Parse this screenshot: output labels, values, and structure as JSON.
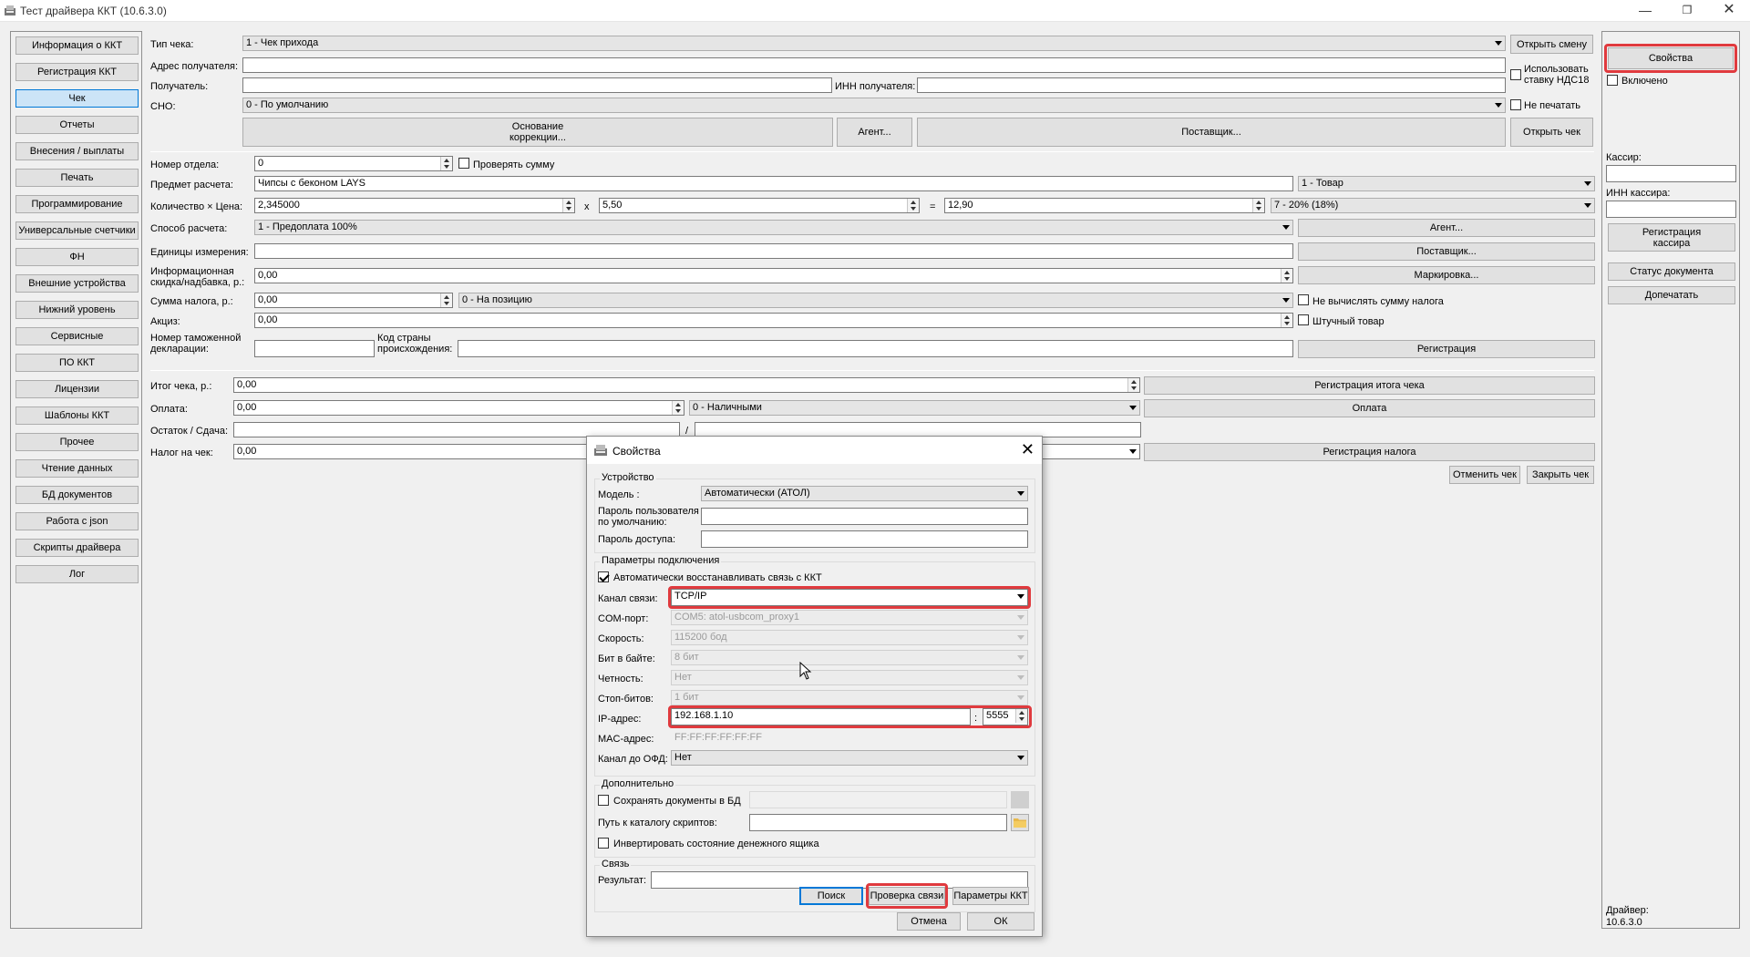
{
  "window": {
    "title": "Тест драйвера ККТ (10.6.3.0)"
  },
  "nav": [
    "Информация о ККТ",
    "Регистрация ККТ",
    "Чек",
    "Отчеты",
    "Внесения / выплаты",
    "Печать",
    "Программирование",
    "Универсальные счетчики",
    "ФН",
    "Внешние устройства",
    "Нижний уровень",
    "Сервисные",
    "ПО ККТ",
    "Лицензии",
    "Шаблоны ККТ",
    "Прочее",
    "Чтение данных",
    "БД документов",
    "Работа с json",
    "Скрипты драйвера",
    "Лог"
  ],
  "receipt": {
    "type_label": "Тип чека:",
    "type_value": "1 - Чек прихода",
    "open_shift": "Открыть смену",
    "addr_label": "Адрес получателя:",
    "use_vat_label": "Использовать\nставку НДС18",
    "recipient_label": "Получатель:",
    "inn_label": "ИНН получателя:",
    "sno_label": "СНО:",
    "sno_value": "0 - По умолчанию",
    "no_print_label": "Не печатать",
    "basis_btn": "Основание\nкоррекции...",
    "agent_btn": "Агент...",
    "supplier_btn": "Поставщик...",
    "open_receipt_btn": "Открыть чек",
    "dept_label": "Номер отдела:",
    "dept_value": "0",
    "check_sum_label": "Проверять сумму",
    "item_label": "Предмет расчета:",
    "item_value": "Чипсы с беконом LAYS",
    "item_type_value": "1 - Товар",
    "qty_price_label": "Количество × Цена:",
    "qty_value": "2,345000",
    "x_sign": "x",
    "price_value": "5,50",
    "eq_sign": "=",
    "total_value": "12,90",
    "vat_value": "7 - 20% (18%)",
    "pay_method_label": "Способ расчета:",
    "pay_method_value": "1 - Предоплата 100%",
    "agent2_btn": "Агент...",
    "unit_label": "Единицы измерения:",
    "supplier2_btn": "Поставщик...",
    "info_discount_label": "Информационная\nскидка/надбавка, р.:",
    "info_discount_value": "0,00",
    "marking_btn": "Маркировка...",
    "tax_sum_label": "Сумма налога, р.:",
    "tax_sum_value": "0,00",
    "tax_mode_value": "0 - На позицию",
    "no_calc_tax_label": "Не вычислять сумму налога",
    "excise_label": "Акциз:",
    "excise_value": "0,00",
    "piece_label": "Штучный товар",
    "customs_label": "Номер таможенной\nдекларации:",
    "country_label": "Код страны\nпроисхождения:",
    "register_btn": "Регистрация",
    "total_label": "Итог чека, р.:",
    "total2_value": "0,00",
    "register_total_btn": "Регистрация итога чека",
    "payment_label": "Оплата:",
    "payment_value": "0,00",
    "payment_type_value": "0 - Наличными",
    "payment_btn": "Оплата",
    "change_label": "Остаток / Сдача:",
    "slash": "/",
    "tax_receipt_label": "Налог на чек:",
    "tax_receipt_value": "0,00",
    "register_tax_btn": "Регистрация налога",
    "cancel_receipt_btn": "Отменить чек",
    "close_receipt_btn": "Закрыть чек"
  },
  "right": {
    "props_btn": "Свойства",
    "enabled_label": "Включено",
    "cashier_label": "Кассир:",
    "cashier_inn_label": "ИНН кассира:",
    "register_cashier_btn": "Регистрация\nкассира",
    "doc_status_btn": "Статус документа",
    "reprint_btn": "Допечатать",
    "driver_label": "Драйвер:",
    "driver_version": "10.6.3.0"
  },
  "dialog": {
    "title": "Свойства",
    "device_group": "Устройство",
    "model_label": "Модель :",
    "model_value": "Автоматически (АТОЛ)",
    "user_pwd_label": "Пароль пользователя\nпо умолчанию:",
    "access_pwd_label": "Пароль доступа:",
    "conn_group": "Параметры подключения",
    "auto_restore_label": "Автоматически восстанавливать связь с ККТ",
    "channel_label": "Канал связи:",
    "channel_value": "TCP/IP",
    "com_label": "COM-порт:",
    "com_value": "COM5: atol-usbcom_proxy1",
    "speed_label": "Скорость:",
    "speed_value": "115200 бод",
    "bits_label": "Бит в байте:",
    "bits_value": "8 бит",
    "parity_label": "Четность:",
    "parity_value": "Нет",
    "stopbits_label": "Стоп-битов:",
    "stopbits_value": "1 бит",
    "ip_label": "IP-адрес:",
    "ip_value": "192.168.1.10",
    "colon": ":",
    "port_value": "5555",
    "mac_label": "MAC-адрес:",
    "mac_value": "FF:FF:FF:FF:FF:FF",
    "ofd_label": "Канал до ОФД:",
    "ofd_value": "Нет",
    "extra_group": "Дополнительно",
    "save_db_label": "Сохранять документы в БД",
    "scripts_path_label": "Путь к каталогу скриптов:",
    "invert_drawer_label": "Инвертировать состояние денежного ящика",
    "link_group": "Связь",
    "result_label": "Результат:",
    "search_btn": "Поиск",
    "check_link_btn": "Проверка связи",
    "kkt_params_btn": "Параметры ККТ",
    "cancel_btn": "Отмена",
    "ok_btn": "ОК"
  }
}
